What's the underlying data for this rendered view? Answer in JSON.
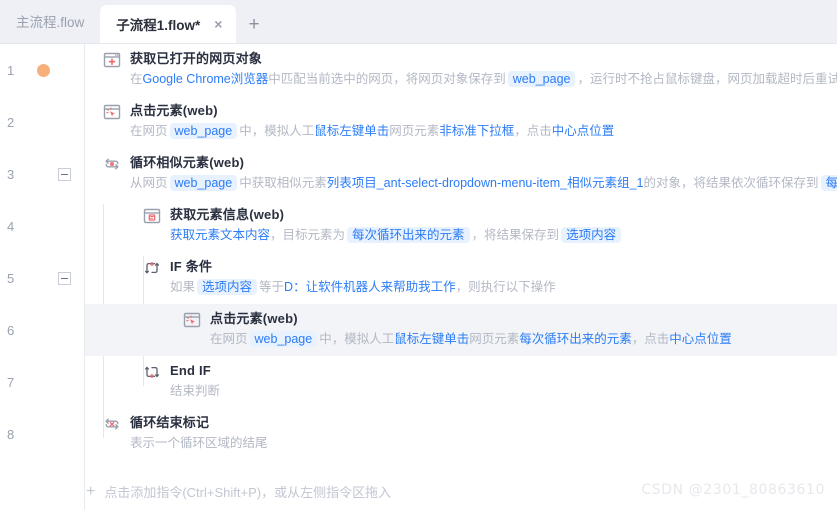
{
  "tabs": {
    "inactive": {
      "label": "主流程.flow"
    },
    "active": {
      "label": "子流程1.flow*",
      "close": "×"
    },
    "add": {
      "label": "+"
    }
  },
  "gutter": {
    "numbers": [
      "1",
      "2",
      "3",
      "4",
      "5",
      "6",
      "7",
      "8"
    ]
  },
  "rows": [
    {
      "num": "1",
      "indent": 0,
      "icon": "browser-get-icon",
      "title": "获取已打开的网页对象",
      "desc": [
        {
          "t": "在",
          "s": "plain"
        },
        {
          "t": "Google Chrome浏览器",
          "s": "blue"
        },
        {
          "t": "中匹配当前选中的网页，将网页对象保存到",
          "s": "plain"
        },
        {
          "t": "web_page",
          "s": "chip"
        },
        {
          "t": "，运行时不抢占鼠标键盘，网页加载超时后重试此...",
          "s": "plain"
        }
      ]
    },
    {
      "num": "2",
      "indent": 0,
      "icon": "click-element-icon",
      "title": "点击元素(web)",
      "desc": [
        {
          "t": "在网页",
          "s": "plain"
        },
        {
          "t": "web_page",
          "s": "chip"
        },
        {
          "t": "中，模拟人工",
          "s": "plain"
        },
        {
          "t": "鼠标左键单击",
          "s": "blue"
        },
        {
          "t": "网页元素",
          "s": "plain"
        },
        {
          "t": "非标准下拉框",
          "s": "blue"
        },
        {
          "t": "，点击",
          "s": "plain"
        },
        {
          "t": "中心点位置",
          "s": "blue"
        }
      ]
    },
    {
      "num": "3",
      "indent": 0,
      "icon": "loop-similar-icon",
      "title": "循环相似元素(web)",
      "desc": [
        {
          "t": "从网页",
          "s": "plain"
        },
        {
          "t": "web_page",
          "s": "chip"
        },
        {
          "t": "中获取相似元素",
          "s": "plain"
        },
        {
          "t": "列表项目_ant-select-dropdown-menu-item_相似元素组_1",
          "s": "blue"
        },
        {
          "t": "的对象，将结果依次循环保存到",
          "s": "plain"
        },
        {
          "t": "每次循",
          "s": "chip"
        }
      ]
    },
    {
      "num": "4",
      "indent": 1,
      "icon": "get-element-info-icon",
      "title": "获取元素信息(web)",
      "desc": [
        {
          "t": "获取元素文本内容",
          "s": "blue"
        },
        {
          "t": "，目标元素为",
          "s": "plain"
        },
        {
          "t": "每次循环出来的元素",
          "s": "chip"
        },
        {
          "t": "，将结果保存到",
          "s": "plain"
        },
        {
          "t": "选项内容",
          "s": "chip"
        }
      ]
    },
    {
      "num": "5",
      "indent": 1,
      "icon": "if-condition-icon",
      "title": "IF 条件",
      "desc": [
        {
          "t": "如果",
          "s": "plain"
        },
        {
          "t": "选项内容",
          "s": "chip"
        },
        {
          "t": "等于",
          "s": "plain"
        },
        {
          "t": "D：让软件机器人来帮助我工作",
          "s": "blue"
        },
        {
          "t": "，则执行以下操作",
          "s": "plain"
        }
      ]
    },
    {
      "num": "6",
      "indent": 2,
      "icon": "click-element-icon",
      "title": "点击元素(web)",
      "highlight": true,
      "desc": [
        {
          "t": "在网页",
          "s": "plain"
        },
        {
          "t": "web_page",
          "s": "chip"
        },
        {
          "t": "中，模拟人工",
          "s": "plain"
        },
        {
          "t": "鼠标左键单击",
          "s": "blue"
        },
        {
          "t": "网页元素",
          "s": "plain"
        },
        {
          "t": "每次循环出来的元素",
          "s": "blue"
        },
        {
          "t": "，点击",
          "s": "plain"
        },
        {
          "t": "中心点位置",
          "s": "blue"
        }
      ]
    },
    {
      "num": "7",
      "indent": 1,
      "icon": "end-if-icon",
      "title": "End IF",
      "desc": [
        {
          "t": "结束判断",
          "s": "plain"
        }
      ]
    },
    {
      "num": "8",
      "indent": 0,
      "icon": "loop-end-icon",
      "title": "循环结束标记",
      "desc": [
        {
          "t": "表示一个循环区域的结尾",
          "s": "plain"
        }
      ]
    }
  ],
  "markers": {
    "breakpoint_row": 0,
    "collapse_rows": [
      2,
      4
    ]
  },
  "footer": {
    "plus": "+",
    "label": "点击添加指令(Ctrl+Shift+P)，或从左侧指令区拖入"
  },
  "watermark": {
    "text": "CSDN @2301_80863610"
  },
  "colors": {
    "accent": "#2b7cf6",
    "chip_bg": "#e8f1fe",
    "tabbar_bg": "#eef0f5",
    "breakpoint": "#f7b07a",
    "row_highlight": "#f2f4f7"
  }
}
